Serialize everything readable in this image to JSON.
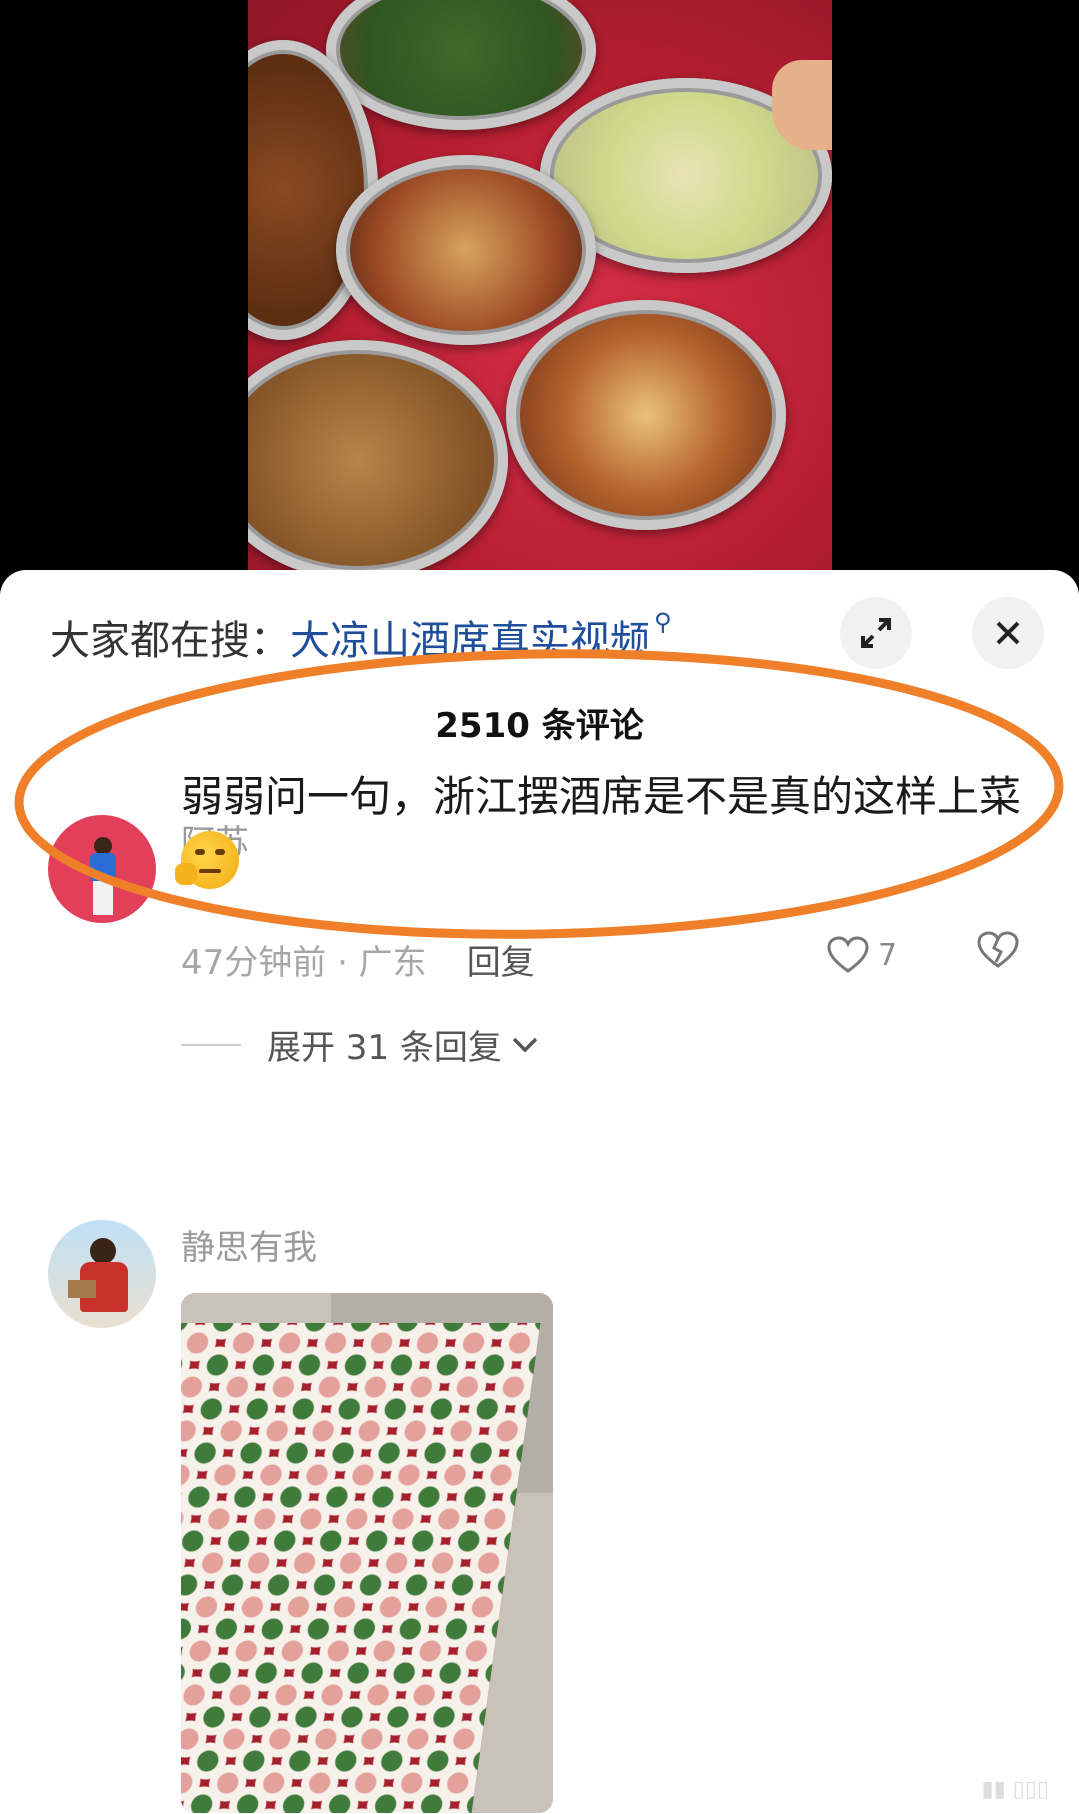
{
  "search": {
    "prefix": "大家都在搜：",
    "keyword": "大凉山酒席真实视频",
    "search_icon": "magnifier-icon"
  },
  "controls": {
    "expand_icon": "expand-icon",
    "close_icon": "close-icon"
  },
  "comments_header": {
    "count_label": "2510 条评论"
  },
  "comments": [
    {
      "username": "阿苏",
      "text": "弱弱问一句，浙江摆酒席是不是真的这样上菜",
      "emoji": "thinking-face-emoji",
      "time": "47分钟前 · 广东",
      "reply_label": "回复",
      "likes": "7",
      "expand_label": "展开 31 条回复"
    },
    {
      "username": "静思有我",
      "photo": "banquet-table-photo"
    }
  ],
  "colors": {
    "highlight_oval": "#f07f2a",
    "link_blue": "#1f4e9b",
    "muted_gray": "#9a9a9a"
  }
}
